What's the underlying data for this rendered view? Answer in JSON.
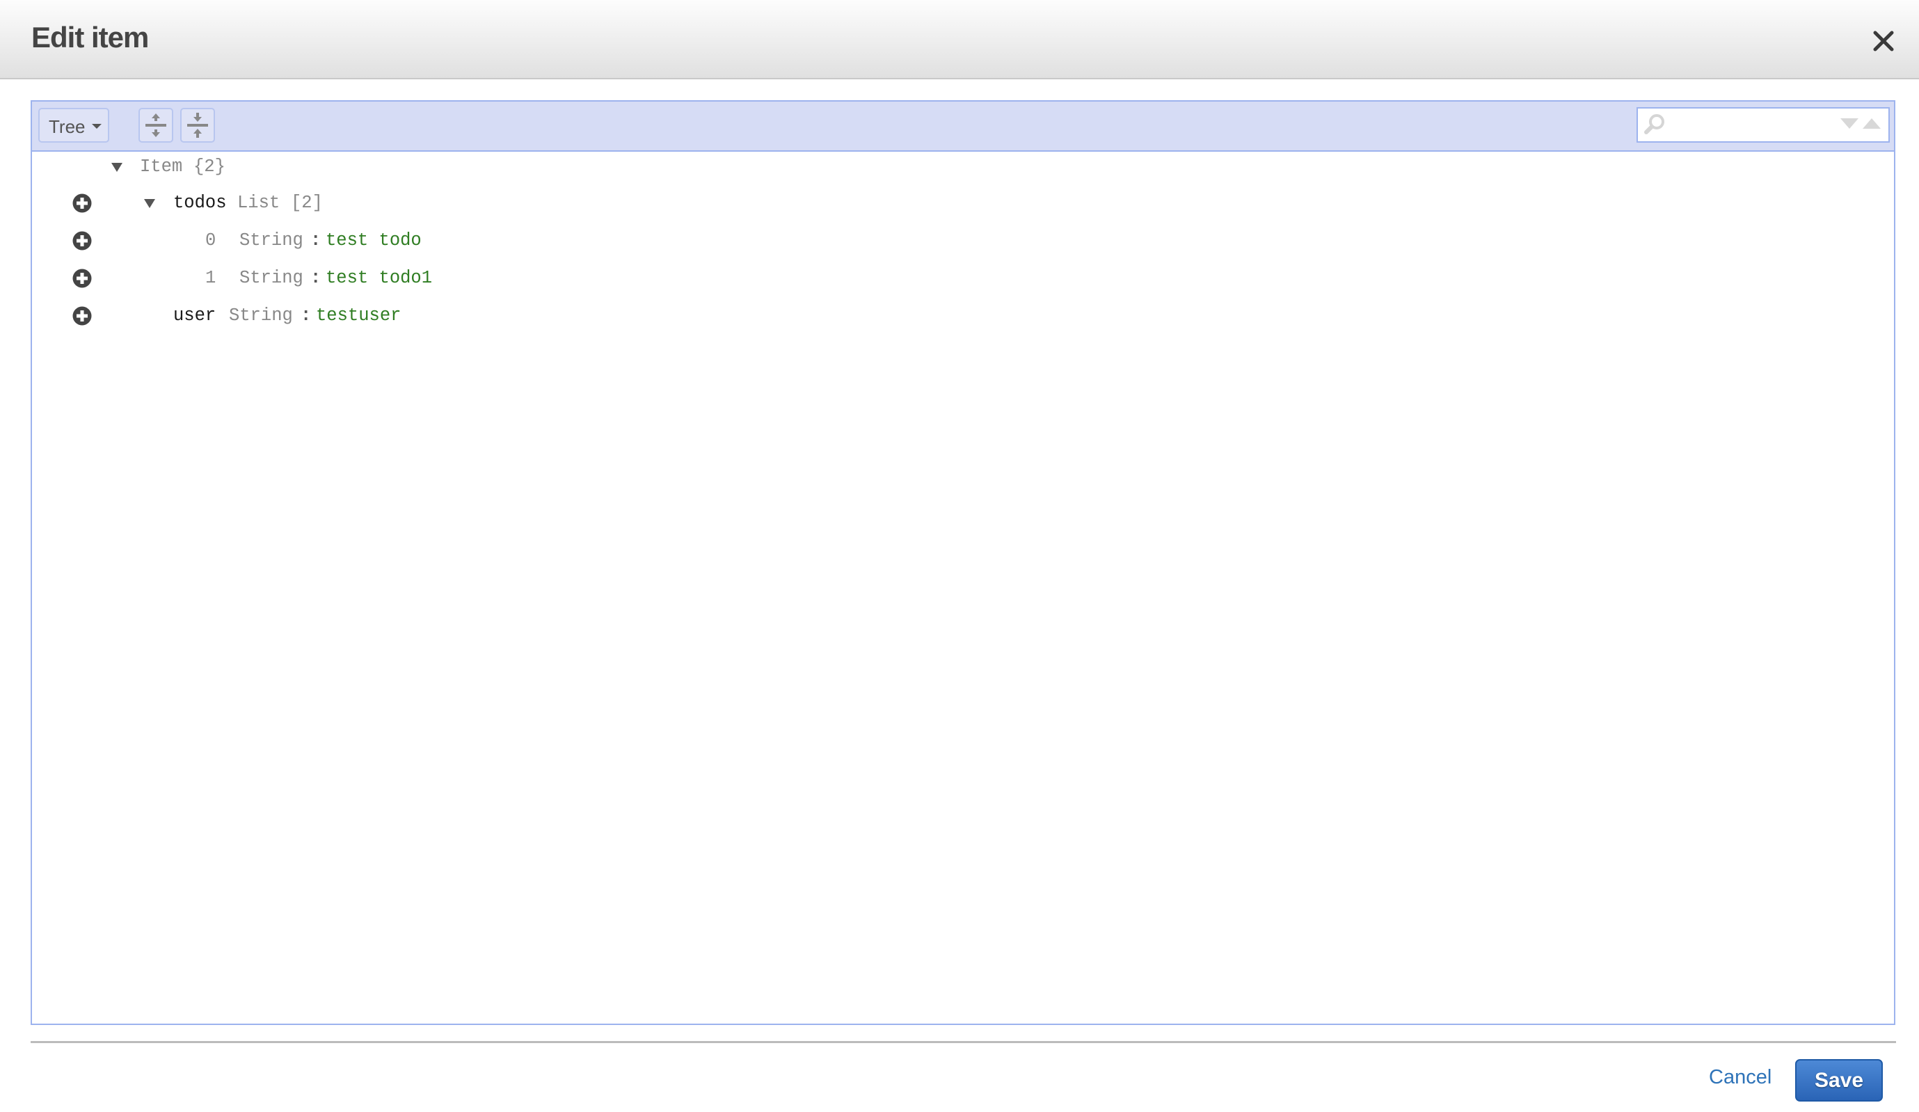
{
  "dialog": {
    "title": "Edit item",
    "close_icon": "close-icon"
  },
  "toolbar": {
    "mode_label": "Tree",
    "mode_icon": "chevron-down-icon",
    "expand_all_icon": "expand-all-icon",
    "collapse_all_icon": "collapse-all-icon",
    "search": {
      "value": "",
      "placeholder": "",
      "search_icon": "search-icon",
      "next_icon": "triangle-down-icon",
      "previous_icon": "triangle-up-icon"
    }
  },
  "tree": {
    "root": {
      "label": "Item",
      "count": "{2}",
      "expanded": true
    },
    "nodes": [
      {
        "key": "todos",
        "type": "List",
        "count": "[2]",
        "expanded": true,
        "children": [
          {
            "index": "0",
            "type": "String",
            "separator": ":",
            "value": "test todo"
          },
          {
            "index": "1",
            "type": "String",
            "separator": ":",
            "value": "test todo1"
          }
        ]
      },
      {
        "key": "user",
        "type": "String",
        "separator": ":",
        "value": "testuser"
      }
    ]
  },
  "footer": {
    "cancel_label": "Cancel",
    "save_label": "Save"
  },
  "colors": {
    "accent": "#2e73b8",
    "save_button": "#2a64b6",
    "editor_border": "#9db3ee",
    "toolbar_bg": "#d6dcf5",
    "value_text": "#2f7d22",
    "type_text": "#888888"
  }
}
